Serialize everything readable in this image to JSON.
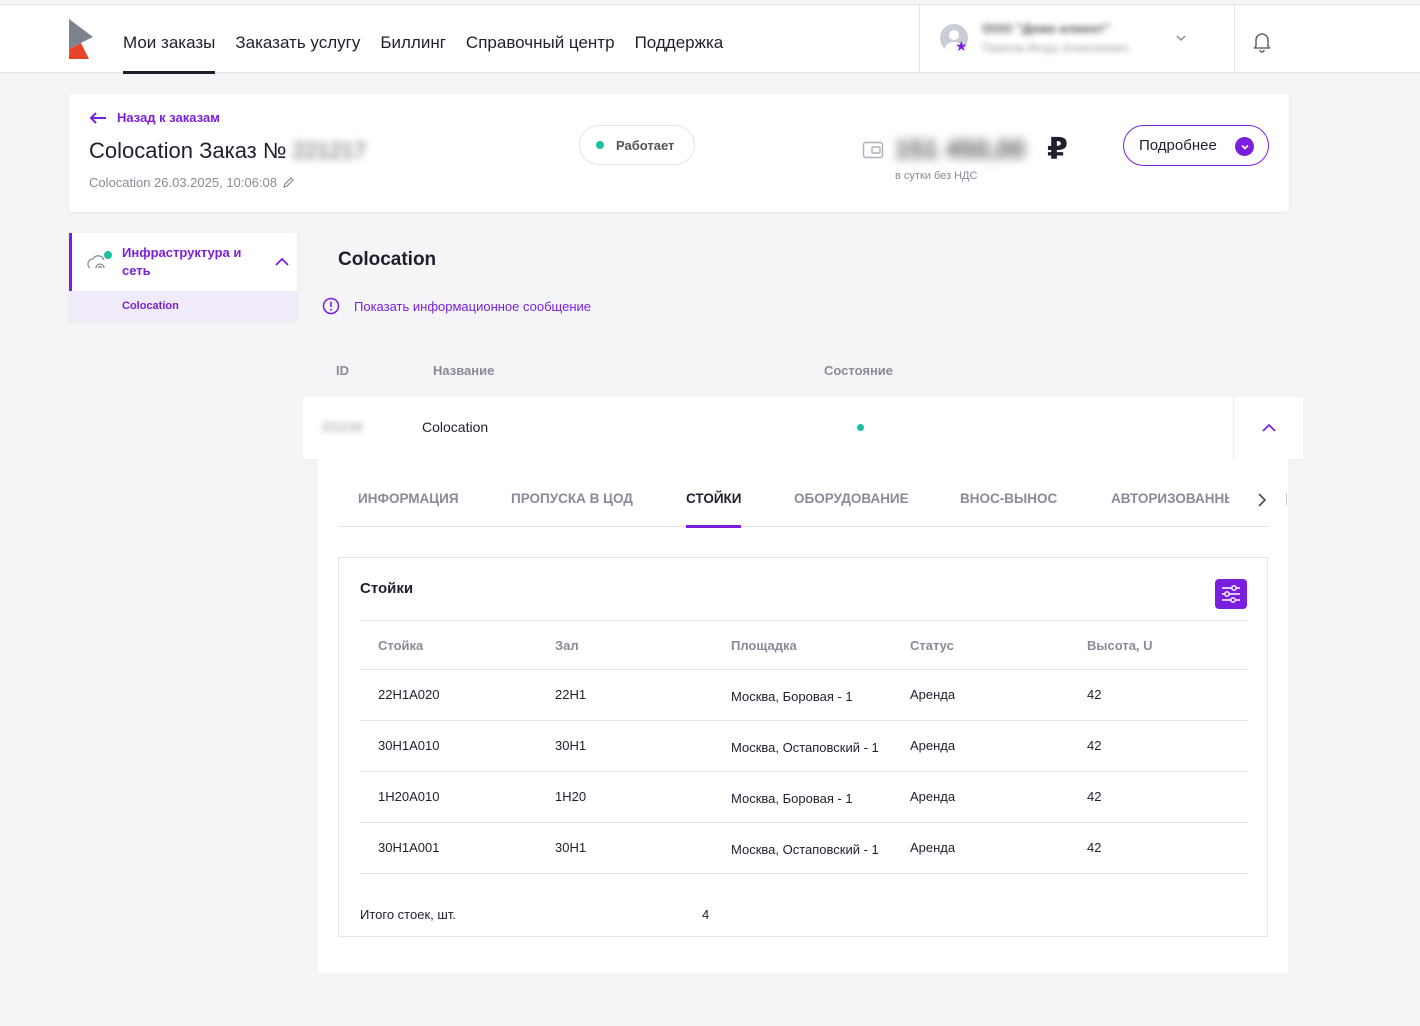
{
  "colors": {
    "accent": "#7a1fe0",
    "status_green": "#1cc0a0",
    "text": "#1f1f2e",
    "muted": "#8a8a98"
  },
  "nav": {
    "items": [
      {
        "label": "Мои заказы",
        "active": true
      },
      {
        "label": "Заказать услугу"
      },
      {
        "label": "Биллинг"
      },
      {
        "label": "Справочный центр"
      },
      {
        "label": "Поддержка"
      }
    ]
  },
  "account": {
    "name": "ООО \"Демо клиент\"",
    "user": "Павлов Игорь Алексеевич"
  },
  "order": {
    "back_label": "Назад к заказам",
    "title_prefix": "Colocation Заказ №",
    "number": "221217",
    "meta": "Colocation 26.03.2025, 10:06:08",
    "status": "Работает",
    "price": "151 450,00",
    "currency": "₽",
    "price_note": "в сутки без НДС",
    "more_label": "Подробнее"
  },
  "sidebar": {
    "group_label": "Инфраструктура и сеть",
    "sub_item": "Colocation"
  },
  "main": {
    "section_title": "Colocation",
    "info_link": "Показать информационное сообщение",
    "columns": {
      "id": "ID",
      "name": "Название",
      "state": "Состояние"
    },
    "row": {
      "id": "221218",
      "name": "Colocation"
    }
  },
  "tabs": [
    {
      "label": "ИНФОРМАЦИЯ"
    },
    {
      "label": "ПРОПУСКА В ЦОД"
    },
    {
      "label": "СТОЙКИ",
      "active": true
    },
    {
      "label": "ОБОРУДОВАНИЕ"
    },
    {
      "label": "ВНОС-ВЫНОС"
    },
    {
      "label": "АВТОРИЗОВАННЫЕ"
    }
  ],
  "racks": {
    "title": "Стойки",
    "headers": [
      "Стойка",
      "Зал",
      "Площадка",
      "Статус",
      "Высота, U"
    ],
    "rows": [
      [
        "22H1A020",
        "22H1",
        "Москва, Боровая - 1",
        "Аренда",
        "42"
      ],
      [
        "30H1A010",
        "30H1",
        "Москва, Остаповский - 1",
        "Аренда",
        "42"
      ],
      [
        "1H20A010",
        "1H20",
        "Москва, Боровая - 1",
        "Аренда",
        "42"
      ],
      [
        "30H1A001",
        "30H1",
        "Москва, Остаповский - 1",
        "Аренда",
        "42"
      ]
    ],
    "total_label": "Итого стоек, шт.",
    "total_value": "4"
  }
}
